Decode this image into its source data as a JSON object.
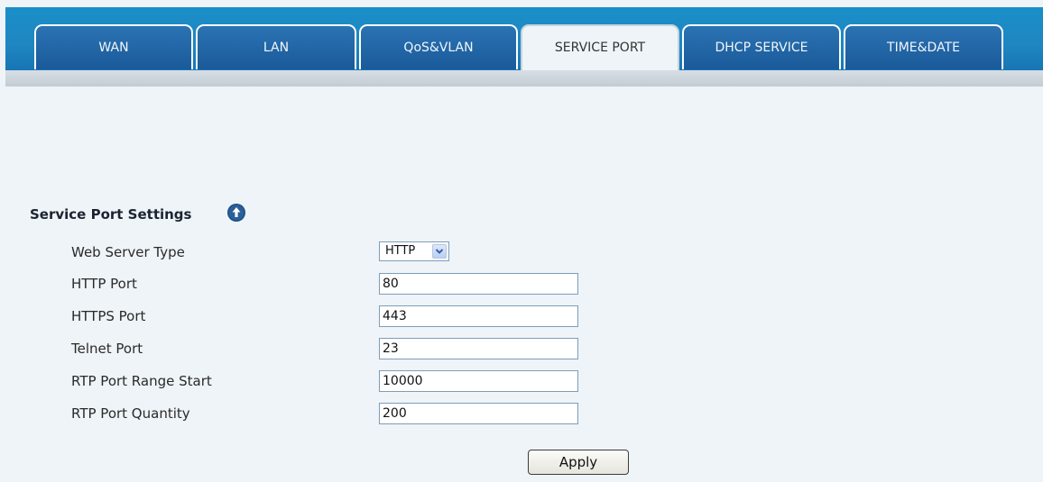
{
  "tabs": [
    {
      "label": "WAN",
      "active": false
    },
    {
      "label": "LAN",
      "active": false
    },
    {
      "label": "QoS&VLAN",
      "active": false
    },
    {
      "label": "SERVICE PORT",
      "active": true
    },
    {
      "label": "DHCP SERVICE",
      "active": false
    },
    {
      "label": "TIME&DATE",
      "active": false
    }
  ],
  "section": {
    "title": "Service Port Settings",
    "help_icon": "help-icon"
  },
  "form": {
    "web_server_type": {
      "label": "Web Server Type",
      "value": "HTTP"
    },
    "http_port": {
      "label": "HTTP Port",
      "value": "80"
    },
    "https_port": {
      "label": "HTTPS Port",
      "value": "443"
    },
    "telnet_port": {
      "label": "Telnet Port",
      "value": "23"
    },
    "rtp_start": {
      "label": "RTP Port Range Start",
      "value": "10000"
    },
    "rtp_quantity": {
      "label": "RTP Port Quantity",
      "value": "200"
    }
  },
  "apply_label": "Apply",
  "colors": {
    "header_blue": "#1a8fc8",
    "tab_blue": "#1a5a9a",
    "page_bg": "#eef4f8"
  }
}
